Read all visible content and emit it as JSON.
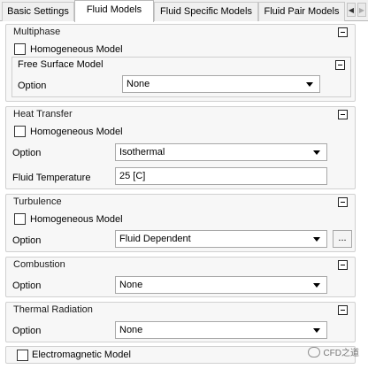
{
  "tabs": [
    {
      "label": "Basic Settings"
    },
    {
      "label": "Fluid Models"
    },
    {
      "label": "Fluid Specific Models"
    },
    {
      "label": "Fluid Pair Models"
    }
  ],
  "active_tab": "Fluid Models",
  "multiphase": {
    "title": "Multiphase",
    "homogeneous_label": "Homogeneous Model",
    "homogeneous_checked": false,
    "free_surface": {
      "title": "Free Surface Model",
      "option_label": "Option",
      "option_value": "None"
    }
  },
  "heat_transfer": {
    "title": "Heat Transfer",
    "homogeneous_label": "Homogeneous Model",
    "homogeneous_checked": false,
    "option_label": "Option",
    "option_value": "Isothermal",
    "fluid_temp_label": "Fluid Temperature",
    "fluid_temp_value": "25 [C]"
  },
  "turbulence": {
    "title": "Turbulence",
    "homogeneous_label": "Homogeneous Model",
    "homogeneous_checked": false,
    "option_label": "Option",
    "option_value": "Fluid Dependent",
    "more_button": "..."
  },
  "combustion": {
    "title": "Combustion",
    "option_label": "Option",
    "option_value": "None"
  },
  "thermal_radiation": {
    "title": "Thermal Radiation",
    "option_label": "Option",
    "option_value": "None"
  },
  "electromagnetic": {
    "label": "Electromagnetic Model",
    "checked": false
  },
  "watermark": "CFD之道"
}
